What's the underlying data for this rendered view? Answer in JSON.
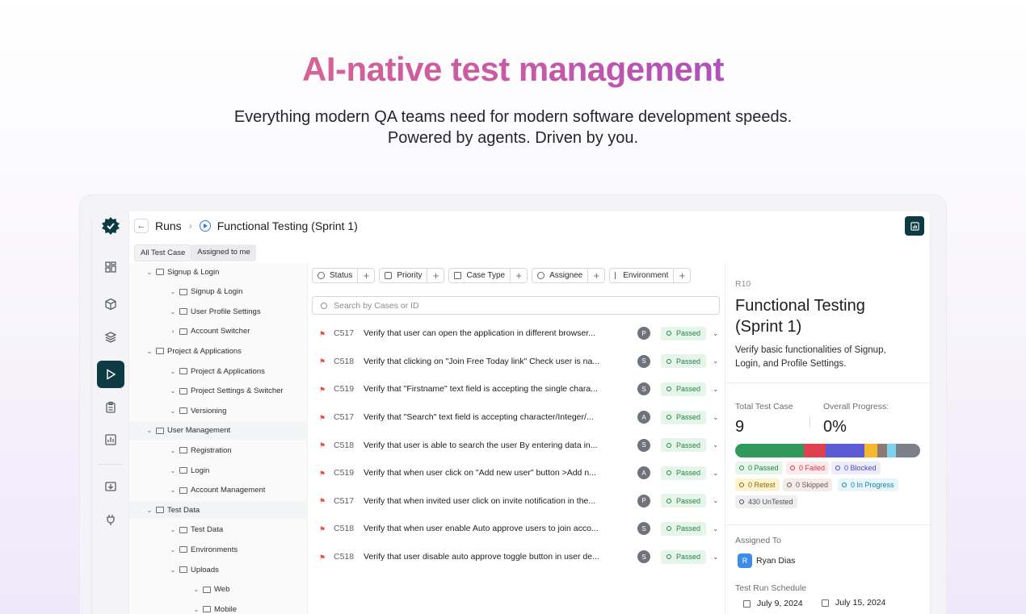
{
  "hero": {
    "title": "AI-native test management",
    "subtitle_line1": "Everything modern QA teams need for modern software development speeds.",
    "subtitle_line2": "Powered by agents. Driven by you."
  },
  "colors": {
    "accent": "#0d3b44",
    "passed_bg": "#e6f5ea",
    "passed_fg": "#258345",
    "link": "#2f7de0"
  },
  "rail": {
    "items": [
      {
        "icon": "dashboard-icon"
      },
      {
        "icon": "cube-icon"
      },
      {
        "icon": "layers-icon"
      },
      {
        "icon": "play-icon",
        "active": true
      },
      {
        "icon": "clipboard-icon"
      },
      {
        "icon": "bar-chart-icon"
      },
      {
        "icon": "download-icon"
      },
      {
        "icon": "plug-icon"
      }
    ]
  },
  "topbar": {
    "runs_label": "Runs",
    "separator": "›",
    "title": "Functional Testing (Sprint 1)"
  },
  "tabs": [
    {
      "label": "All Test Case",
      "active": true
    },
    {
      "label": "Assigned to me",
      "active": false
    }
  ],
  "tree": [
    {
      "label": "Signup & Login",
      "level": 0,
      "open": true
    },
    {
      "label": "Signup & Login",
      "level": 1,
      "open": true
    },
    {
      "label": "User Profile Settings",
      "level": 1,
      "open": true
    },
    {
      "label": "Account Switcher",
      "level": 1,
      "open": false
    },
    {
      "label": "Project & Applications",
      "level": 0,
      "open": true
    },
    {
      "label": "Project & Applications",
      "level": 1,
      "open": true
    },
    {
      "label": "Project Settings & Switcher",
      "level": 1,
      "open": true
    },
    {
      "label": "Versioning",
      "level": 1,
      "open": true
    },
    {
      "label": "User Management",
      "level": 0,
      "open": true,
      "highlight": true
    },
    {
      "label": "Registration",
      "level": 1,
      "open": true
    },
    {
      "label": "Login",
      "level": 1,
      "open": true
    },
    {
      "label": "Account Management",
      "level": 1,
      "open": true
    },
    {
      "label": "Test Data",
      "level": 0,
      "open": true,
      "highlight": true
    },
    {
      "label": "Test Data",
      "level": 1,
      "open": true
    },
    {
      "label": "Environments",
      "level": 1,
      "open": true
    },
    {
      "label": "Uploads",
      "level": 1,
      "open": true
    },
    {
      "label": "Web",
      "level": 2,
      "open": true
    },
    {
      "label": "Mobile",
      "level": 2,
      "open": true
    }
  ],
  "filters": [
    {
      "label": "Status",
      "icon": "circle-icon"
    },
    {
      "label": "Priority",
      "icon": "bell-icon"
    },
    {
      "label": "Case Type",
      "icon": "hierarchy-icon"
    },
    {
      "label": "Assignee",
      "icon": "user-icon"
    },
    {
      "label": "Environment",
      "icon": "env-icon"
    }
  ],
  "search": {
    "placeholder": "Search by Cases or ID"
  },
  "cases": [
    {
      "id": "C517",
      "title": "Verify that user can open the application in different browser...",
      "assignee": "P",
      "status": "Passed"
    },
    {
      "id": "C518",
      "title": "Verify that clicking on \"Join Free Today link\" Check user is na...",
      "assignee": "S",
      "status": "Passed"
    },
    {
      "id": "C519",
      "title": "Verify that \"Firstname\" text field is accepting the single chara...",
      "assignee": "S",
      "status": "Passed"
    },
    {
      "id": "C517",
      "title": "Verify that \"Search\" text field is accepting character/Integer/...",
      "assignee": "A",
      "status": "Passed"
    },
    {
      "id": "C518",
      "title": "Verify that user is able to search the user By entering data in...",
      "assignee": "S",
      "status": "Passed"
    },
    {
      "id": "C519",
      "title": "Verify that when user click on \"Add new user\" button >Add n...",
      "assignee": "A",
      "status": "Passed"
    },
    {
      "id": "C517",
      "title": "Verify that when invited user click on invite notification in the...",
      "assignee": "P",
      "status": "Passed"
    },
    {
      "id": "C518",
      "title": "Verify that when user enable Auto approve users to join acco...",
      "assignee": "S",
      "status": "Passed"
    },
    {
      "id": "C518",
      "title": "Verify that user disable auto approve toggle button in user de...",
      "assignee": "S",
      "status": "Passed"
    }
  ],
  "panel": {
    "run_id": "R10",
    "title": "Functional Testing (Sprint 1)",
    "description": "Verify basic functionalities of Signup, Login, and Profile Settings.",
    "total_label": "Total Test Case",
    "total_value": "9",
    "progress_label": "Overall Progress:",
    "progress_value": "0%",
    "progress_segments": [
      {
        "name": "passed",
        "color": "#2f9a5b",
        "fraction": 0.37
      },
      {
        "name": "failed",
        "color": "#e0414e",
        "fraction": 0.12
      },
      {
        "name": "blocked",
        "color": "#5b5bd6",
        "fraction": 0.21
      },
      {
        "name": "retest",
        "color": "#f5b82e",
        "fraction": 0.07
      },
      {
        "name": "skipped",
        "color": "#8d7b73",
        "fraction": 0.05
      },
      {
        "name": "in_progress",
        "color": "#7dd3f0",
        "fraction": 0.05
      },
      {
        "name": "untested",
        "color": "#7d808a",
        "fraction": 0.13
      }
    ],
    "chips": {
      "passed": "0 Passed",
      "failed": "0 Failed",
      "blocked": "0 Blocked",
      "retest": "0 Retest",
      "skipped": "0 Skipped",
      "in_progress": "0 In Progress",
      "untested": "430 UnTested"
    },
    "assigned_label": "Assigned To",
    "assignee_initial": "R",
    "assignee_name": "Ryan Dias",
    "schedule_label": "Test Run Schedule",
    "start_date": "July 9, 2024",
    "end_date": "July 15, 2024"
  }
}
